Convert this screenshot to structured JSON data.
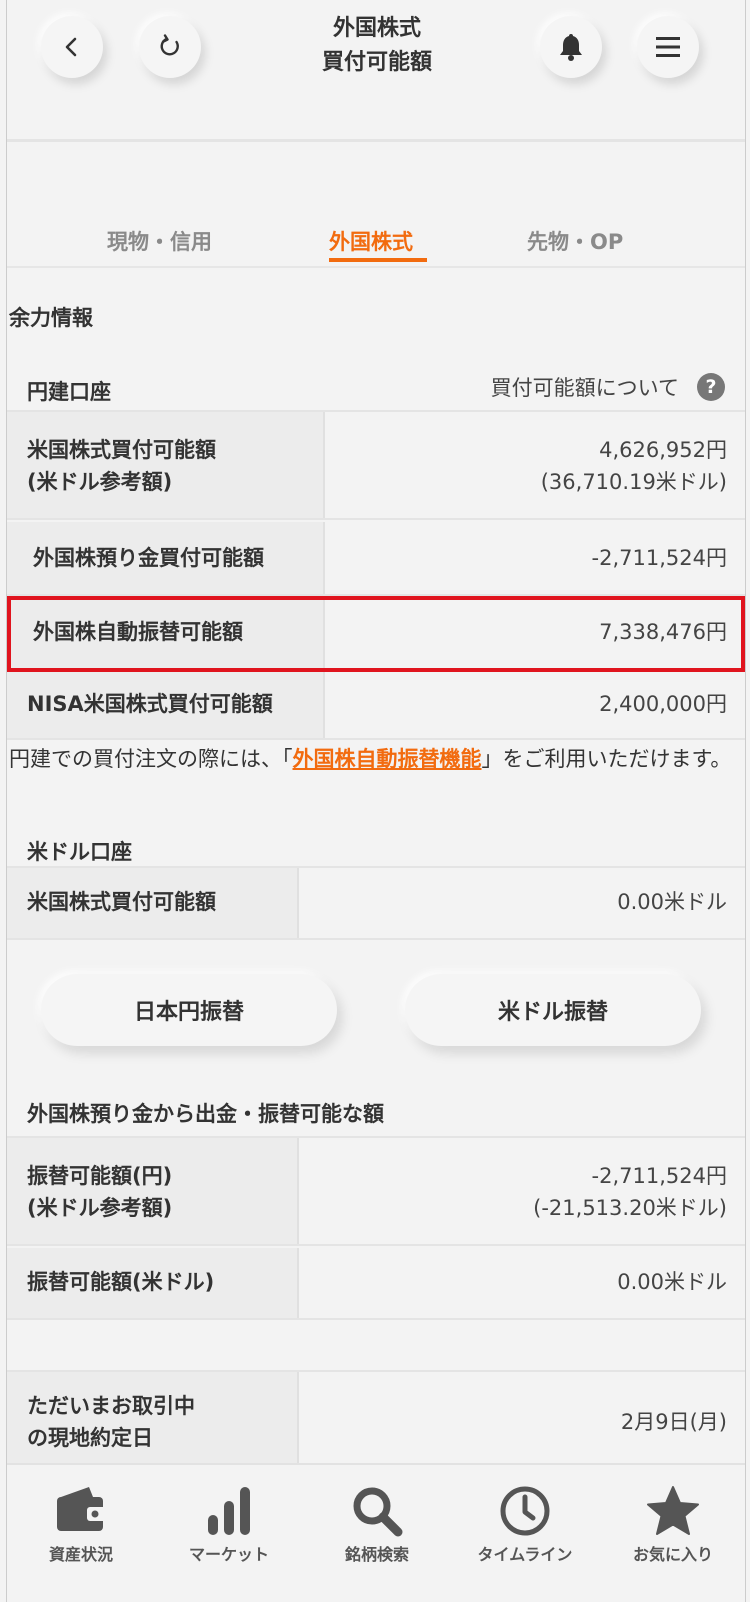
{
  "header": {
    "title_line1": "外国株式",
    "title_line2": "買付可能額"
  },
  "tabs": [
    {
      "label": "現物・信用",
      "active": false
    },
    {
      "label": "外国株式",
      "active": true
    },
    {
      "label": "先物・OP",
      "active": false
    }
  ],
  "section_title": "余力情報",
  "yen_account": {
    "title": "円建口座",
    "help_link": "買付可能額について",
    "rows": [
      {
        "label_line1": "米国株式買付可能額",
        "label_line2": "(米ドル参考額)",
        "value_line1": "4,626,952円",
        "value_line2": "(36,710.19米ドル)"
      },
      {
        "label_line1": "外国株預り金買付可能額",
        "value_line1": "-2,711,524円"
      },
      {
        "label_line1": "外国株自動振替可能額",
        "value_line1": "7,338,476円"
      },
      {
        "label_line1": "NISA米国株式買付可能額",
        "value_line1": "2,400,000円"
      }
    ]
  },
  "note": {
    "before": "円建での買付注文の際には、「",
    "link": "外国株自動振替機能",
    "after": "」をご利用いただけます。"
  },
  "usd_account": {
    "title": "米ドル口座",
    "rows": [
      {
        "label_line1": "米国株式買付可能額",
        "value_line1": "0.00米ドル"
      }
    ]
  },
  "buttons": {
    "yen_transfer": "日本円振替",
    "usd_transfer": "米ドル振替"
  },
  "withdraw": {
    "title": "外国株預り金から出金・振替可能な額",
    "rows": [
      {
        "label_line1": "振替可能額(円)",
        "label_line2": "(米ドル参考額)",
        "value_line1": "-2,711,524円",
        "value_line2": "(-21,513.20米ドル)"
      },
      {
        "label_line1": "振替可能額(米ドル)",
        "value_line1": "0.00米ドル"
      }
    ]
  },
  "settlement": {
    "label_line1": "ただいまお取引中",
    "label_line2": "の現地約定日",
    "value": "2月9日(月)"
  },
  "bottom_nav": [
    {
      "label": "資産状況",
      "icon": "wallet-icon"
    },
    {
      "label": "マーケット",
      "icon": "bar-chart-icon"
    },
    {
      "label": "銘柄検索",
      "icon": "search-icon"
    },
    {
      "label": "タイムライン",
      "icon": "clock-icon"
    },
    {
      "label": "お気に入り",
      "icon": "star-icon"
    }
  ],
  "colors": {
    "accent": "#f26b0f",
    "highlight_border": "#e0141e",
    "background": "#f3f3f3",
    "label_bg": "#ececec"
  }
}
